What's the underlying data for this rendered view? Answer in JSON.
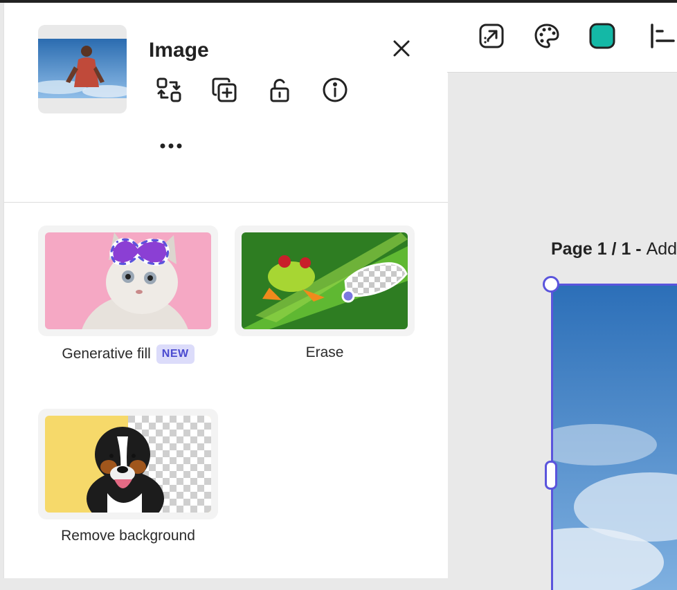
{
  "panel": {
    "title": "Image",
    "close_icon": "close-icon",
    "actions": [
      {
        "name": "replace-icon",
        "label": "Replace"
      },
      {
        "name": "duplicate-icon",
        "label": "Duplicate"
      },
      {
        "name": "unlock-icon",
        "label": "Lock"
      },
      {
        "name": "info-icon",
        "label": "Info"
      }
    ],
    "more_icon": "more-icon"
  },
  "tools": [
    {
      "label": "Generative fill",
      "badge": "NEW"
    },
    {
      "label": "Erase"
    },
    {
      "label": "Remove background"
    }
  ],
  "canvas": {
    "page_label_bold": "Page 1 / 1 - ",
    "page_label_rest": "Add title",
    "toolbar": [
      {
        "name": "animate-icon"
      },
      {
        "name": "palette-icon"
      },
      {
        "name": "color-swatch",
        "color": "#14b8a6"
      },
      {
        "name": "align-icon"
      }
    ]
  },
  "colors": {
    "accent": "#5a54dc",
    "swatch": "#14b8a6",
    "badge_bg": "#dcdcfa",
    "badge_fg": "#4a4ad0"
  }
}
